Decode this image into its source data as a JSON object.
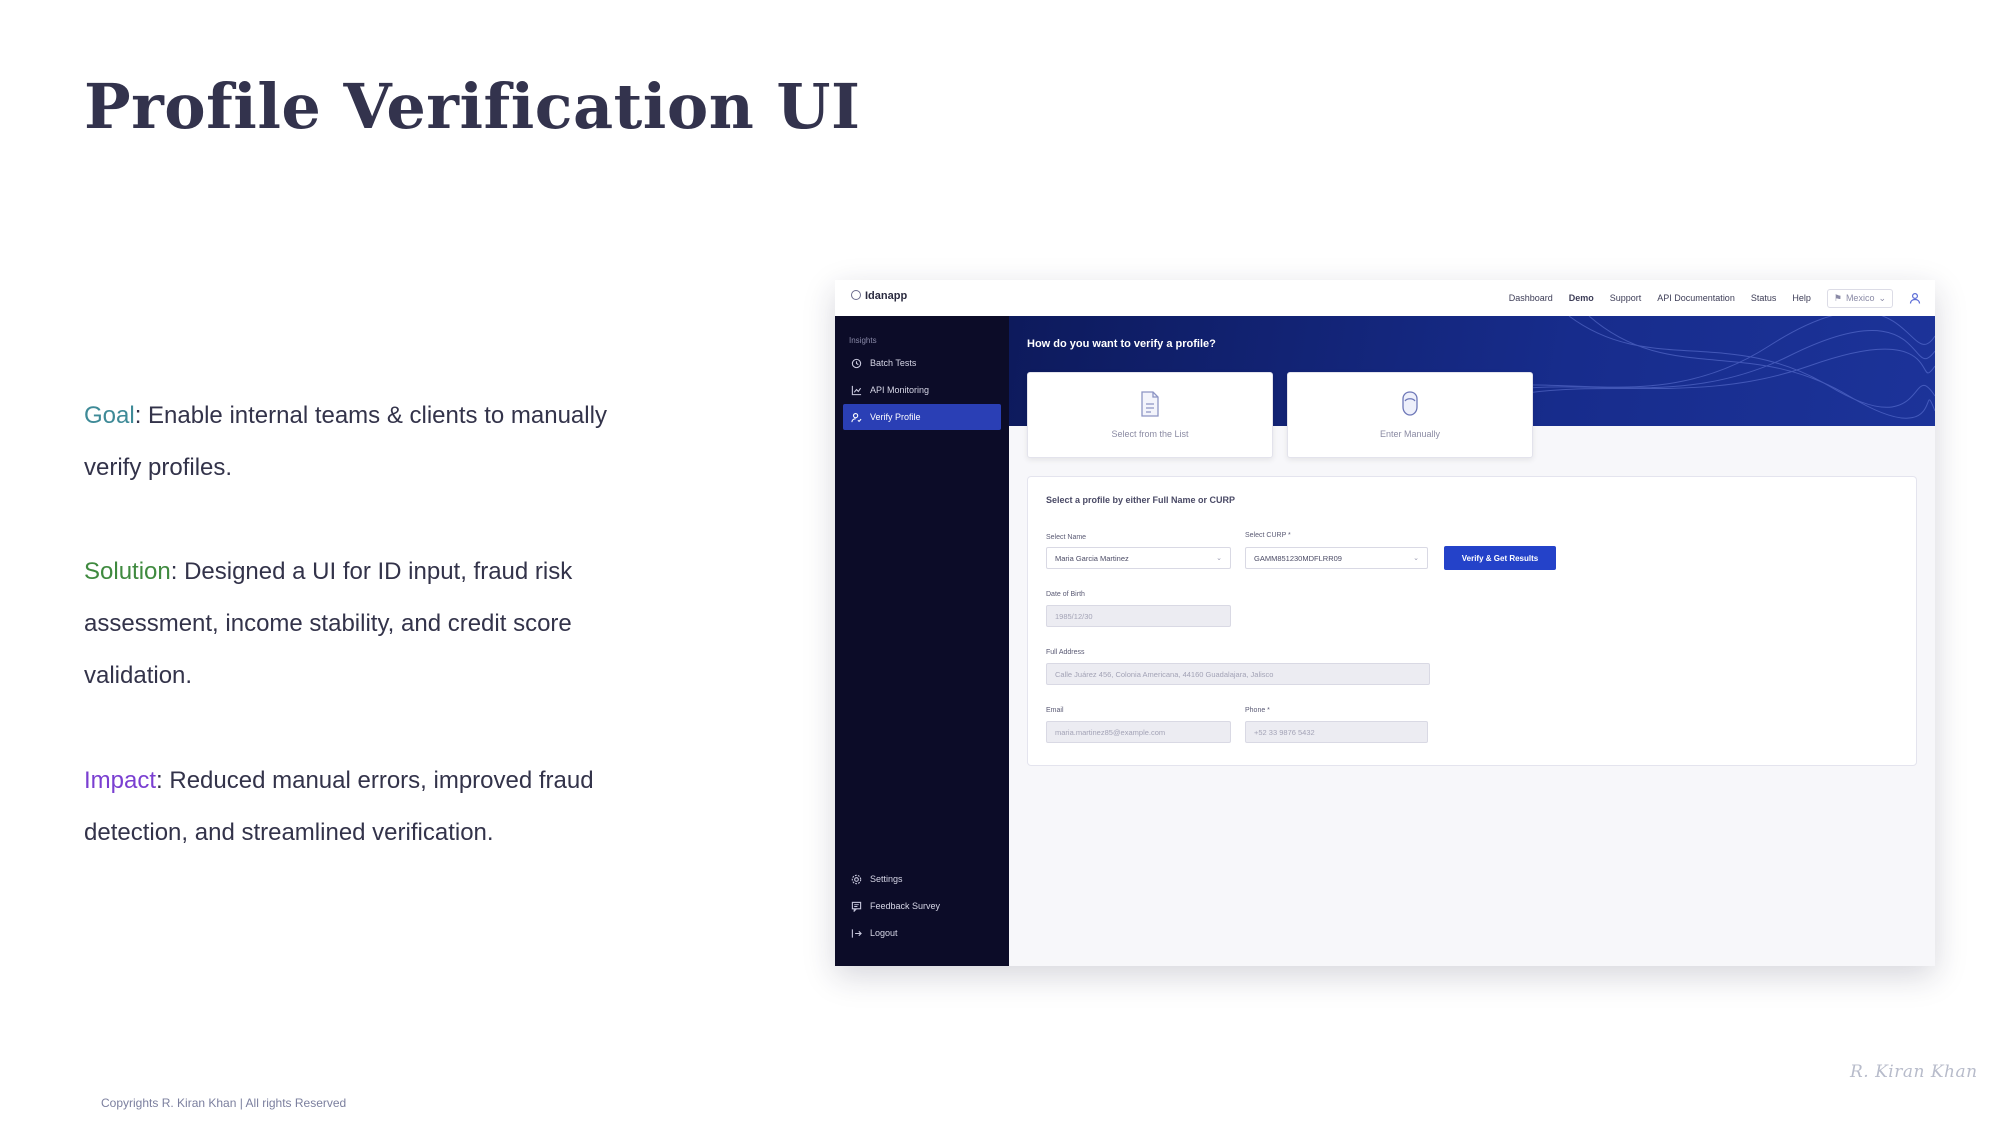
{
  "slide": {
    "title": "Profile Verification UI",
    "goal": {
      "key": "Goal",
      "text": ": Enable internal teams & clients to manually verify profiles."
    },
    "solution": {
      "key": "Solution",
      "text": ": Designed a UI for ID input, fraud risk assessment, income stability, and credit score validation."
    },
    "impact": {
      "key": "Impact",
      "text": ": Reduced manual errors, improved fraud detection, and streamlined verification."
    },
    "copyright": "Copyrights R. Kiran Khan | All rights Reserved",
    "signature": "R. Kiran Khan",
    "colors": {
      "goal": "#3e8a97",
      "solution": "#3f8a3f",
      "impact": "#7a3fd1",
      "title": "#33334d"
    }
  },
  "app": {
    "brand": "Idanapp",
    "nav": [
      "Dashboard",
      "Demo",
      "Support",
      "API Documentation",
      "Status",
      "Help"
    ],
    "nav_active": "Demo",
    "country": "Mexico",
    "sidebar": {
      "section": "Insights",
      "items": [
        {
          "label": "Batch Tests",
          "icon": "history-icon"
        },
        {
          "label": "API Monitoring",
          "icon": "chart-icon"
        },
        {
          "label": "Verify Profile",
          "icon": "user-check-icon",
          "active": true
        }
      ],
      "bottom_items": [
        {
          "label": "Settings",
          "icon": "gear-icon"
        },
        {
          "label": "Feedback Survey",
          "icon": "feedback-icon"
        },
        {
          "label": "Logout",
          "icon": "logout-icon"
        }
      ]
    },
    "banner_title": "How do you want to verify a profile?",
    "options": [
      {
        "label": "Select from the List",
        "icon": "document-icon"
      },
      {
        "label": "Enter Manually",
        "icon": "face-scan-icon"
      }
    ],
    "form": {
      "heading": "Select a profile by either Full Name or CURP",
      "select_name": {
        "label": "Select Name",
        "value": "Maria Garcia Martinez"
      },
      "select_curp": {
        "label": "Select CURP *",
        "value": "GAMM851230MDFLRR09"
      },
      "verify_button": "Verify & Get Results",
      "dob": {
        "label": "Date of Birth",
        "value": "1985/12/30"
      },
      "address": {
        "label": "Full Address",
        "value": "Calle Juárez 456, Colonia Americana, 44160 Guadalajara, Jalisco"
      },
      "email": {
        "label": "Email",
        "value": "maria.martinez85@example.com"
      },
      "phone": {
        "label": "Phone *",
        "value": "+52 33 9876 5432"
      }
    },
    "colors": {
      "sidebar": "#0c0c28",
      "accent": "#2a3fb5",
      "banner": "#172c8c"
    }
  }
}
